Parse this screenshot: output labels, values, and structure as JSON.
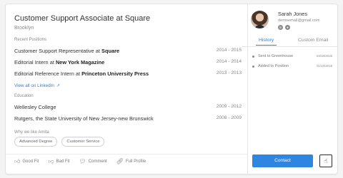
{
  "header": {
    "title": "Customer Support Associate at Square",
    "location": "Brooklyn"
  },
  "positions": {
    "label": "Recent Positions",
    "items": [
      {
        "prefix": "Customer Support Representative at ",
        "company": "Square",
        "years": "2014 - 2015"
      },
      {
        "prefix": "Editorial Intern at ",
        "company": "New York Magazine",
        "years": "2014 - 2014"
      },
      {
        "prefix": "Editorial Reference Intern at ",
        "company": "Princeton University Press",
        "years": "2013 - 2013"
      }
    ]
  },
  "linkedin": {
    "label": "View all on LinkedIn",
    "icon": "external-link-icon"
  },
  "education": {
    "label": "Education",
    "items": [
      {
        "school": "Wellesley College",
        "years": "2009 - 2012"
      },
      {
        "school": "Rutgers, the State University of New Jersey-new Brunswick",
        "years": "2008 - 2009"
      }
    ]
  },
  "why": {
    "label": "Why we like Amita",
    "tags": [
      "Advanced Degree",
      "Customer Service"
    ]
  },
  "actions": [
    {
      "label": "Good Fit",
      "icon": "thumbs-up-icon"
    },
    {
      "label": "Bad Fit",
      "icon": "thumbs-down-icon"
    },
    {
      "label": "Comment",
      "icon": "comment-icon"
    },
    {
      "label": "Full Profile",
      "icon": "link-icon"
    }
  ],
  "person": {
    "name": "Sarah Jones",
    "email": "demoemail@gmail.com",
    "social": [
      "linkedin-icon",
      "github-icon"
    ]
  },
  "tabs": {
    "history": "History",
    "email": "Custom Email"
  },
  "history": [
    {
      "text": "Sent to Greenhouse",
      "date": "04/16/2018"
    },
    {
      "text": "Added to Position",
      "date": "01/10/2018"
    }
  ],
  "buttons": {
    "contact": "Contact",
    "hand_icon": "pointer-hand-icon"
  },
  "colors": {
    "accent": "#2f86e0",
    "link": "#2f7ed8"
  }
}
